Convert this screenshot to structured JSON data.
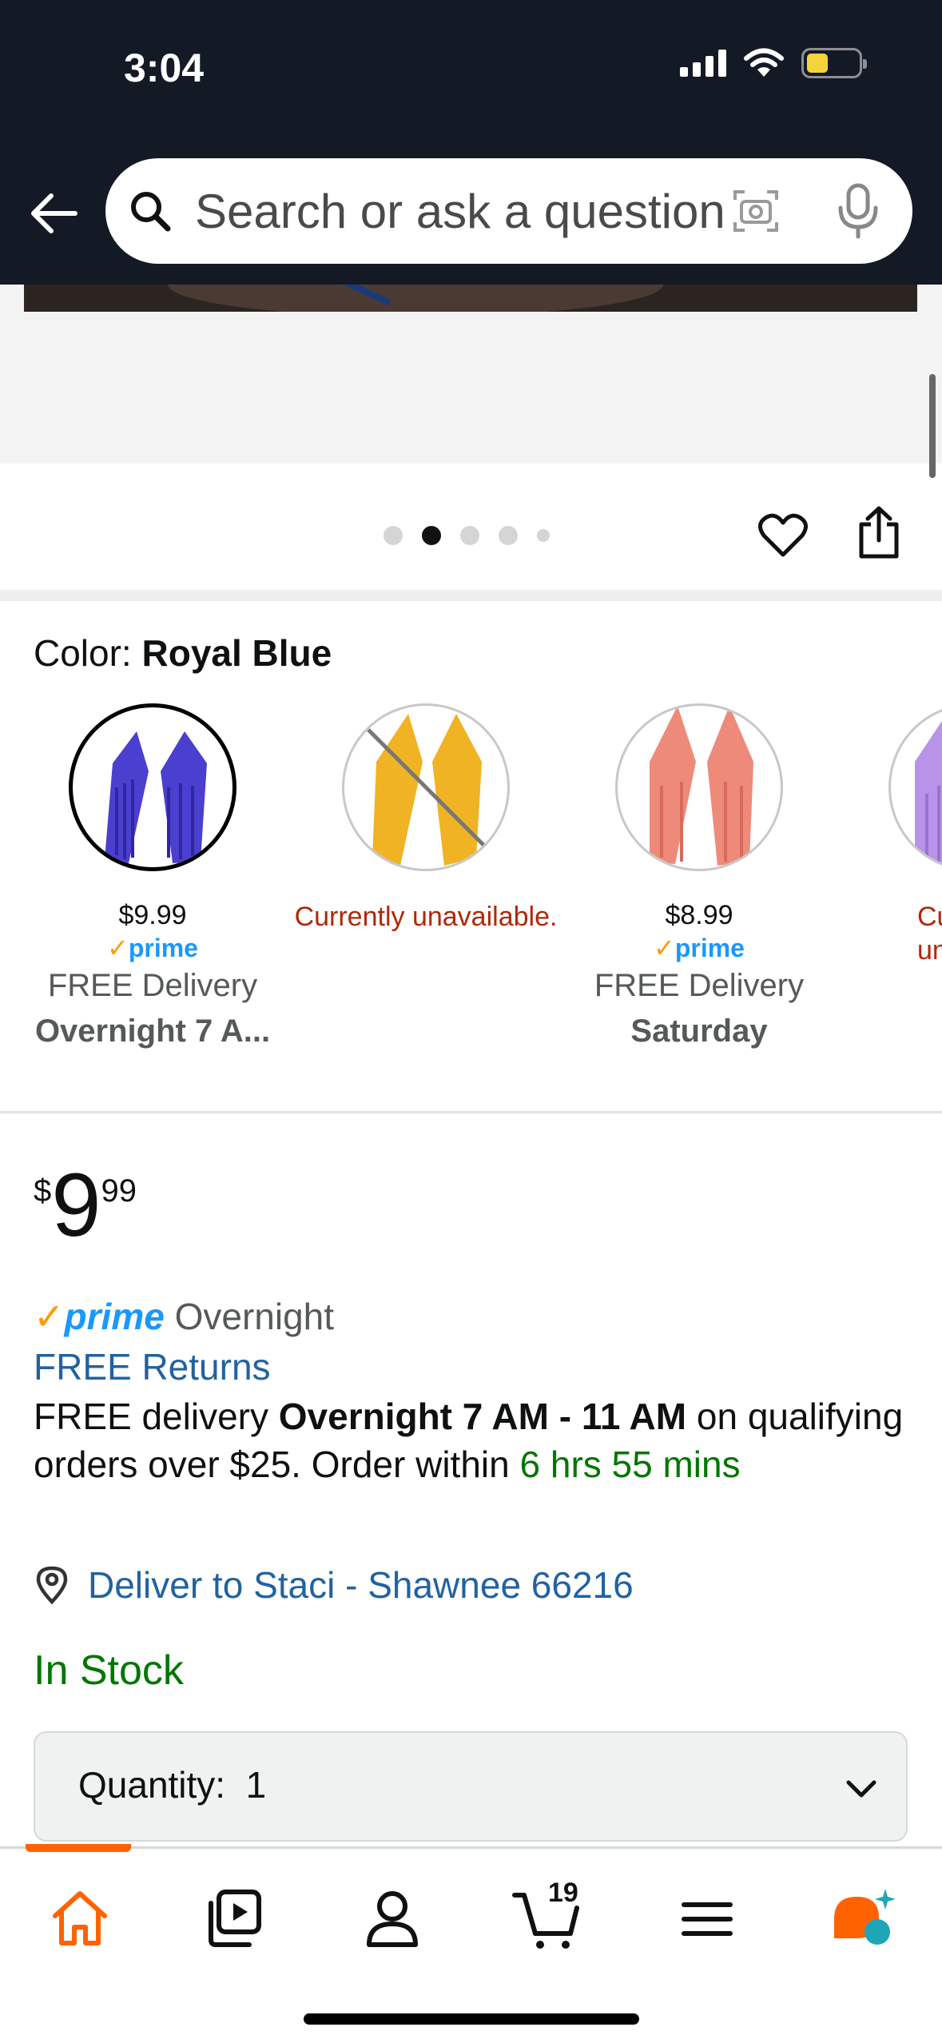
{
  "status_bar": {
    "time": "3:04"
  },
  "search": {
    "placeholder": "Search or ask a question"
  },
  "gallery": {
    "dot_count": 5,
    "active_dot": 1
  },
  "color_selector": {
    "label": "Color:",
    "selected_color": "Royal Blue",
    "options": [
      {
        "name": "Royal Blue",
        "color": "#4a3fcf",
        "price": "$9.99",
        "prime": "prime",
        "delivery": "FREE Delivery",
        "when": "Overnight 7 A...",
        "selected": true
      },
      {
        "name": "Gold",
        "color": "#f0b323",
        "status": "Currently unavailable."
      },
      {
        "name": "Coral",
        "color": "#ee8a7a",
        "price": "$8.99",
        "prime": "prime",
        "delivery": "FREE Delivery",
        "when": "Saturday"
      },
      {
        "name": "Lavender",
        "color": "#b993e8",
        "status": "Currently unavailable."
      }
    ]
  },
  "price": {
    "currency": "$",
    "whole": "9",
    "fraction": "99"
  },
  "prime": {
    "logo": "prime",
    "speed": "Overnight"
  },
  "free_returns": "FREE Returns",
  "delivery": {
    "prefix": "FREE delivery ",
    "window": "Overnight 7 AM - 11 AM",
    "middle": " on qualifying orders over $25. Order within ",
    "countdown": "6 hrs 55 mins"
  },
  "deliver_to": "Deliver to Staci - Shawnee 66216",
  "stock": "In Stock",
  "quantity": {
    "label": "Quantity:",
    "value": "1"
  },
  "tabbar": {
    "cart_count": "19"
  },
  "colors": {
    "link": "#2162a1",
    "success": "#007600",
    "error": "#b12704",
    "accent": "#ff6200",
    "prime_blue": "#1a98ff",
    "header": "#131a26"
  }
}
